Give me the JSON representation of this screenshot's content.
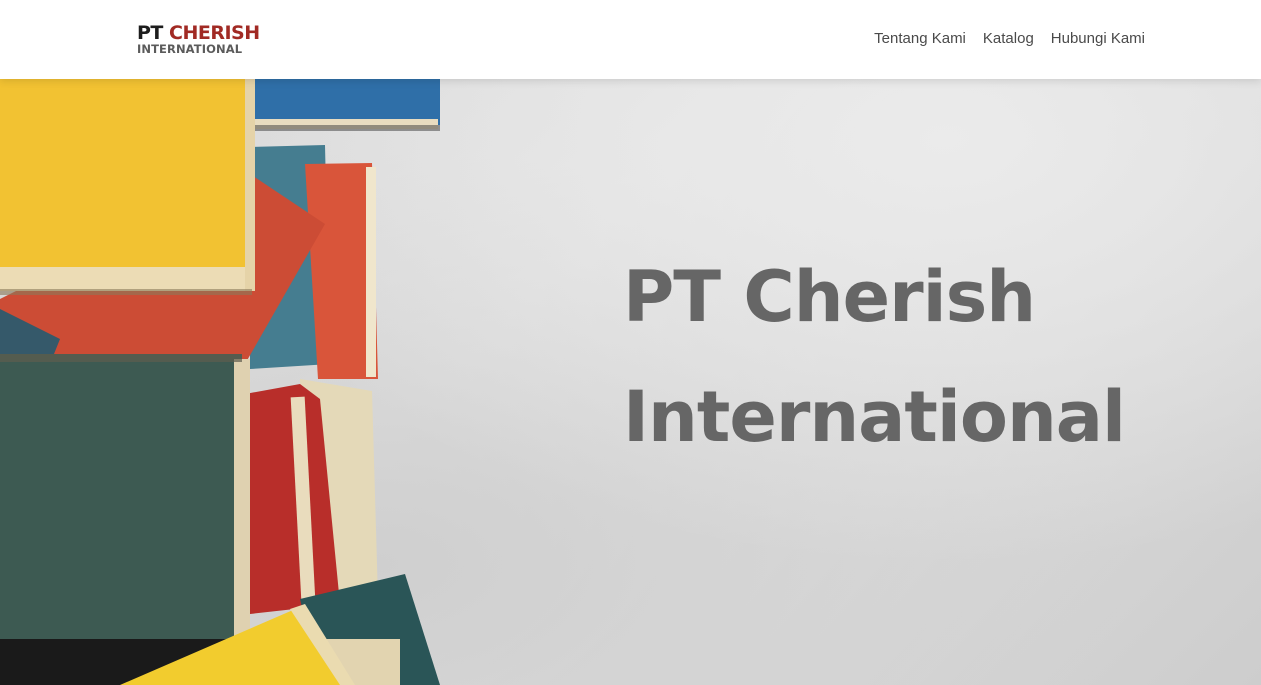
{
  "header": {
    "logo": {
      "line1_prefix": "PT",
      "line1_name": "CHERISH",
      "line2": "INTERNATIONAL"
    },
    "nav": [
      {
        "label": "Tentang Kami"
      },
      {
        "label": "Katalog"
      },
      {
        "label": "Hubungi Kami"
      }
    ]
  },
  "hero": {
    "title_line1": "PT Cherish",
    "title_line2": "International",
    "image": "stack-of-books-image"
  },
  "colors": {
    "brand_red": "#a12a24",
    "logo_dark": "#1d1d1d",
    "logo_gray": "#5b5b5b",
    "nav_text": "#4a4a4a",
    "hero_title": "#666666"
  }
}
